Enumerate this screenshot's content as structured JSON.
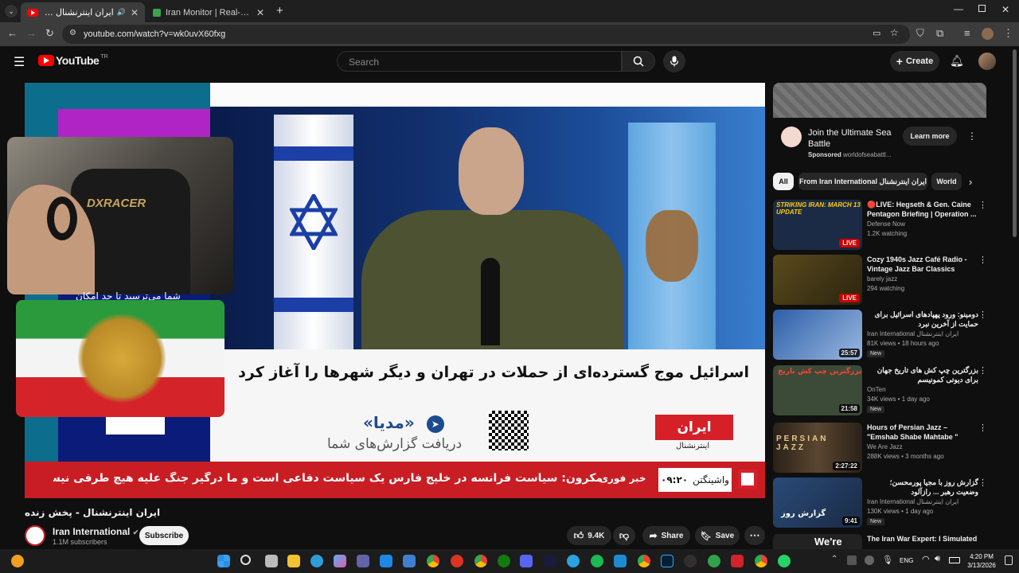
{
  "browser": {
    "tabs": [
      {
        "title": "ایران اینترنشنال - پخش زنده",
        "active": true
      },
      {
        "title": "Iran Monitor | Real-Time OSINT",
        "active": false
      }
    ],
    "url": "youtube.com/watch?v=wk0uvX60fxg"
  },
  "youtube": {
    "logo": "YouTube",
    "logo_sup": "TR",
    "search_placeholder": "Search",
    "create_label": "Create"
  },
  "video": {
    "headline": "اسرائیل موج گسترده‌ای از حملات در تهران و دیگر شهرها را آغاز کرد",
    "ticker": "مکرون: سیاست فرانسه در خلیج فارس یک سیاست دفاعی است و ما درگیر جنگ علیه هیچ طرفی نیستیم",
    "breaking_label": "خبر فوری",
    "clock_city": "واشینگتن",
    "clock_time": "۰۹:۲۰",
    "telegram_title": "«مدیا»",
    "telegram_sub": "دریافت گزارش‌های شما",
    "logo_iran": "ایران",
    "logo_intl": "اینترنشنال",
    "webcam_caption": "شما می‌ترسید تا حد امکان",
    "chair_brand": "DXRACER"
  },
  "watch": {
    "title": "ایران اینترنشنال - پخش زنده",
    "channel": "Iran International",
    "subscribers": "1.1M subscribers",
    "subscribe_label": "Subscribe",
    "likes": "9.4K",
    "share_label": "Share",
    "save_label": "Save"
  },
  "ad": {
    "title": "Join the Ultimate Sea Battle",
    "sponsored": "Sponsored",
    "domain": "worldofseabattl...",
    "cta": "Learn more"
  },
  "chips": [
    "All",
    "From Iran International ایران اینترنشنال",
    "World"
  ],
  "recommendations": [
    {
      "title": "🔴LIVE: Hegseth & Gen. Caine Pentagon Briefing | Operation ...",
      "channel": "Defense Now",
      "meta": "1.2K watching",
      "badge": "LIVE",
      "thumb_text": "STRIKING IRAN: MARCH 13 UPDATE",
      "thumb_color": "#1b2a45"
    },
    {
      "title": "Cozy 1940s Jazz Café Radio - Vintage Jazz Bar Classics",
      "channel": "barely jazz",
      "meta": "294 watching",
      "badge": "LIVE",
      "thumb_text": "",
      "thumb_color": "#5a4a1c"
    },
    {
      "title": "دومینو: ورود پهپادهای اسرائیل برای حمایت از آخرین نبرد",
      "channel": "Iran International ایران اینترنشنال",
      "meta": "81K views • 18 hours ago",
      "badge": "25:57",
      "new": "New",
      "thumb_text": "",
      "thumb_color": "#2c5fa8"
    },
    {
      "title": "بزرگترین چپ کش های تاریخ جهان برای دیوتی کمونیسم",
      "channel": "OnTen",
      "meta": "34K views • 1 day ago",
      "badge": "21:58",
      "new": "New",
      "thumb_text": "بزرگترین چپ کش تاریخ",
      "thumb_color": "#3c4a38"
    },
    {
      "title": "Hours of Persian Jazz – \"Emshab Shabe Mahtabe \"",
      "channel": "We Are Jazz",
      "meta": "288K views • 3 months ago",
      "badge": "2:27:22",
      "thumb_text": "PERSIAN JAZZ",
      "thumb_color": "#2a2118"
    },
    {
      "title": "گزارش روز با مجیا پورمحسن؛ وضعیت رهبر ... رازآلود",
      "channel": "Iran International ایران اینترنشنال",
      "meta": "130K views • 1 day ago",
      "badge": "9:41",
      "new": "New",
      "thumb_text": "گزارش روز",
      "thumb_color": "#2a4a78"
    },
    {
      "title": "The Iran War Expert: I Simulated",
      "channel": "",
      "meta": "",
      "badge": "",
      "thumb_text": "We're",
      "thumb_color": "#222"
    }
  ],
  "taskbar": {
    "lang": "ENG",
    "time": "4:20 PM",
    "date": "3/13/2026"
  }
}
